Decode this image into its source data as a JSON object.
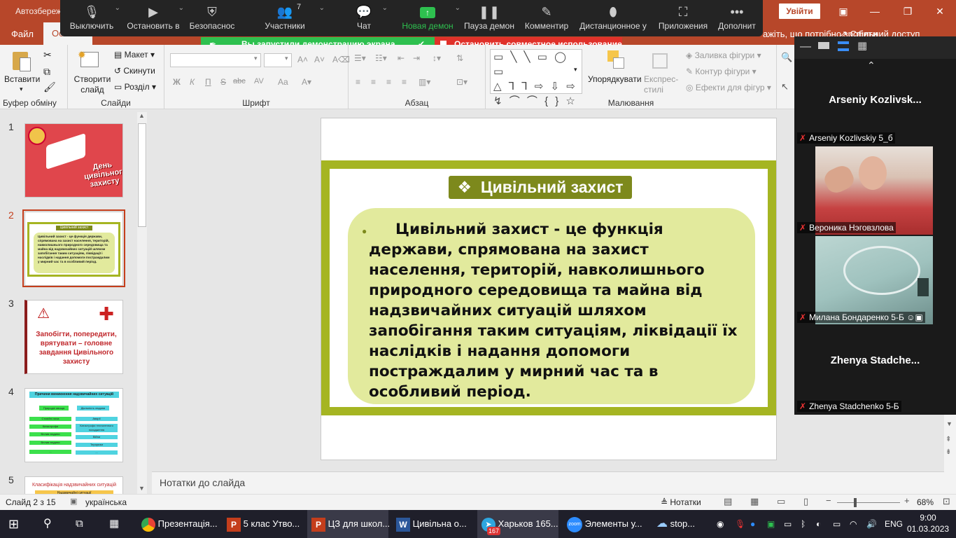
{
  "titlebar": {
    "title": "Автозбереж",
    "signin": "Увійти",
    "share": "Спільний доступ",
    "tellme": "ажіть, що потрібно зробити"
  },
  "ribbon_tabs": [
    "Файл",
    "Осн"
  ],
  "zoom_toolbar": [
    {
      "label": "Выключить",
      "icon": "microphone-icon"
    },
    {
      "label": "Остановить в",
      "icon": "video-camera-icon"
    },
    {
      "label": "Безопаснос",
      "icon": "shield-icon"
    },
    {
      "label": "Участники",
      "icon": "participants-icon",
      "count": "7"
    },
    {
      "label": "Чат",
      "icon": "chat-icon"
    },
    {
      "label": "Новая демон",
      "icon": "share-screen-icon"
    },
    {
      "label": "Пауза демон",
      "icon": "pause-icon"
    },
    {
      "label": "Комментир",
      "icon": "annotate-pencil-icon"
    },
    {
      "label": "Дистанционное у",
      "icon": "mouse-icon"
    },
    {
      "label": "Приложения",
      "icon": "apps-icon"
    },
    {
      "label": "Дополнит",
      "icon": "more-icon"
    }
  ],
  "share_banner": {
    "green": "Вы запустили демонстрацию экрана",
    "red": "Остановить совместное использование"
  },
  "ribbon": {
    "clipboard": {
      "paste": "Вставити",
      "group": "Буфер обміну"
    },
    "slides": {
      "new_slide": "Створити слайд",
      "layout": "Макет",
      "reset": "Скинути",
      "section": "Розділ",
      "group": "Слайди"
    },
    "font": {
      "bold": "Ж",
      "italic": "К",
      "underline": "П",
      "strike": "abc",
      "spacing": "AV",
      "case": "Aa",
      "group": "Шрифт"
    },
    "paragraph": {
      "group": "Абзац"
    },
    "drawing": {
      "arrange": "Упорядкувати",
      "quick_styles": "Експрес-стилі",
      "fill": "Заливка фігури",
      "outline": "Контур фігури",
      "effects": "Ефекти для фігур",
      "group": "Малювання"
    }
  },
  "thumbnails": [
    {
      "num": "1",
      "caption": "День цивільного захисту"
    },
    {
      "num": "2",
      "title": "Цивільний захист",
      "text": "Цивільний захист - це функція держави, спрямована на захист населення, територій, навколишнього природного середовища та майна від надзвичайних ситуацій шляхом запобігання таким ситуаціям, ліквідації і наслідків і надання допомоги постраждалим у мирний час та в особливий період."
    },
    {
      "num": "3",
      "text": "Запобігти, попередити, врятувати – головне завдання Цивільного захисту"
    },
    {
      "num": "4",
      "title": "Причини виникнення надзвичайних ситуацій",
      "left": [
        "Природні явища",
        "Стихійні лиха",
        "Катастрофи",
        "Вплив людини",
        "Вплив людини",
        "..."
      ],
      "right": [
        "Діяльність людини",
        "Аварії",
        "Катастрофи техногенного походження",
        "Війни",
        "Тероризм",
        "..."
      ]
    },
    {
      "num": "5",
      "title": "Класифікація надзвичайних ситуацій",
      "sub": "Надзвичайні ситуації"
    }
  ],
  "slide": {
    "title_symbol": "❖",
    "title": "Цивільний захист",
    "body": "Цивільний захист - це функція держави, спрямована на захист населення, територій, навколишнього природного середовища та майна від надзвичайних ситуацій шляхом запобігання таким ситуаціям, ліквідації їх наслідків і надання допомоги постраждалим у мирний час та в особливий період."
  },
  "notes_placeholder": "Нотатки до слайда",
  "statusbar": {
    "slide": "Слайд 2 з 15",
    "language": "українська",
    "notes": "Нотатки",
    "zoom": "68%"
  },
  "gallery": {
    "participants": [
      {
        "big": "Arseniy  Kozlivsk...",
        "name": "Arseniy Kozlivskiy 5_б"
      },
      {
        "name": "Вероника Нэговзлова"
      },
      {
        "name": "Милана Бондаренко 5-Б"
      },
      {
        "big": "Zhenya  Stadche...",
        "name": "Zhenya Stadchenko 5-Б"
      }
    ]
  },
  "taskbar": {
    "apps": [
      {
        "label": "Презентація...",
        "icon": "chrome-icon"
      },
      {
        "label": "5 клас Утво...",
        "icon": "powerpoint-icon"
      },
      {
        "label": "ЦЗ для школ...",
        "icon": "powerpoint-icon"
      },
      {
        "label": "Цивільна о...",
        "icon": "word-icon"
      },
      {
        "label": "Харьков 165...",
        "icon": "telegram-icon",
        "badge": "167"
      },
      {
        "label": "Элементы у...",
        "icon": "zoom-icon"
      },
      {
        "label": "stop...",
        "icon": "weather-icon"
      }
    ],
    "lang": "ENG",
    "time": "9:00",
    "date": "01.03.2023"
  },
  "colors": {
    "accent": "#b7472a",
    "slide_frame": "#a5b522",
    "slide_box": "#e2ea9d",
    "title_box": "#7d891c",
    "zoom_green": "#2ec04f",
    "zoom_red": "#e0312a"
  }
}
